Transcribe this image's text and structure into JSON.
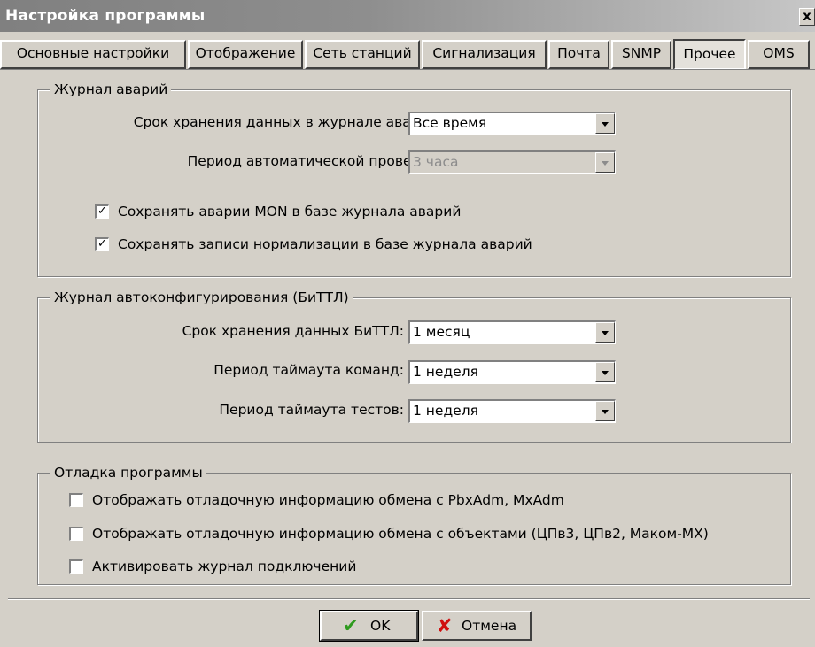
{
  "window": {
    "title": "Настройка программы",
    "close_glyph": "x"
  },
  "tabs": [
    {
      "label": "Основные настройки",
      "active": false
    },
    {
      "label": "Отображение",
      "active": false
    },
    {
      "label": "Сеть станций",
      "active": false
    },
    {
      "label": "Сигнализация",
      "active": false
    },
    {
      "label": "Почта",
      "active": false
    },
    {
      "label": "SNMP",
      "active": false
    },
    {
      "label": "Прочее",
      "active": true
    },
    {
      "label": "OMS",
      "active": false
    }
  ],
  "alarm_log": {
    "legend": "Журнал аварий",
    "retention_label": "Срок хранения данных в журнале аварий:",
    "retention_value": "Все время",
    "check_period_label": "Период автоматической проверки:",
    "check_period_value": "3 часа",
    "save_mon": {
      "label": "Сохранять аварии MON в базе журнала аварий",
      "checked": true
    },
    "save_norm": {
      "label": "Сохранять записи нормализации в базе журнала аварий",
      "checked": true
    }
  },
  "autoconf_log": {
    "legend": "Журнал автоконфигурирования (БиТТЛ)",
    "retention_label": "Срок хранения данных БиТТЛ:",
    "retention_value": "1 месяц",
    "cmd_timeout_label": "Период таймаута команд:",
    "cmd_timeout_value": "1 неделя",
    "test_timeout_label": "Период таймаута тестов:",
    "test_timeout_value": "1 неделя"
  },
  "debug": {
    "legend": "Отладка программы",
    "pbx": {
      "label": "Отображать отладочную информацию обмена с PbxAdm, MxAdm",
      "checked": false
    },
    "objects": {
      "label": "Отображать отладочную информацию обмена с объектами (ЦПв3, ЦПв2, Маком-МХ)",
      "checked": false
    },
    "conn_log": {
      "label": "Активировать журнал подключений",
      "checked": false
    }
  },
  "buttons": {
    "ok": {
      "label": "OK",
      "icon": "check-icon",
      "color": "#2e9a1e"
    },
    "cancel": {
      "label": "Отмена",
      "icon": "cross-icon",
      "color": "#d01010"
    }
  },
  "colors": {
    "face": "#d4d0c8",
    "title_start": "#808080",
    "title_end": "#c7c7c7"
  }
}
